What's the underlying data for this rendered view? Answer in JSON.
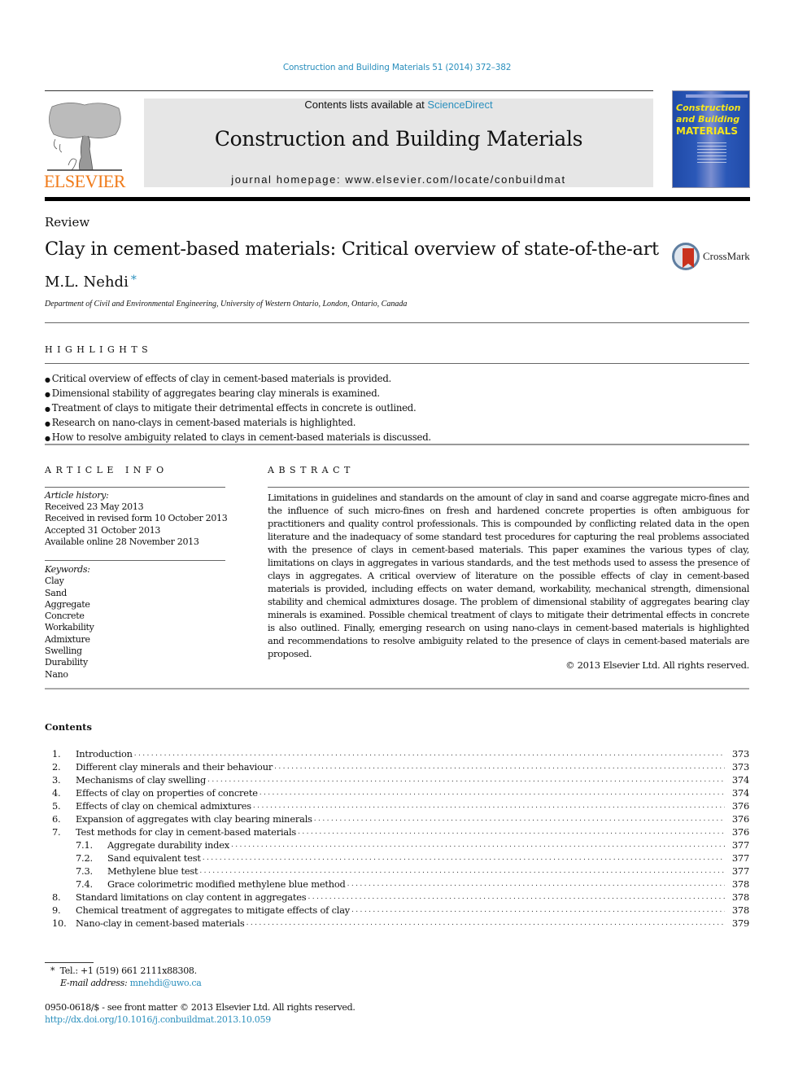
{
  "citation": "Construction and Building Materials 51 (2014) 372–382",
  "header": {
    "publisher_logo_text": "ELSEVIER",
    "contents_prefix": "Contents lists available at ",
    "contents_link": "ScienceDirect",
    "journal_title": "Construction and Building Materials",
    "homepage_prefix": "journal homepage: ",
    "homepage_url": "www.elsevier.com/locate/conbuildmat",
    "cover": {
      "line1": "Construction",
      "line2": "and Building",
      "line3": "MATERIALS"
    }
  },
  "article": {
    "type": "Review",
    "title": "Clay in cement-based materials: Critical overview of state-of-the-art",
    "author": "M.L. Nehdi",
    "author_mark": "*",
    "affiliation": "Department of Civil and Environmental Engineering, University of Western Ontario, London, Ontario, Canada",
    "crossmark_label": "CrossMark"
  },
  "highlights": {
    "heading": "HIGHLIGHTS",
    "items": [
      "Critical overview of effects of clay in cement-based materials is provided.",
      "Dimensional stability of aggregates bearing clay minerals is examined.",
      "Treatment of clays to mitigate their detrimental effects in concrete is outlined.",
      "Research on nano-clays in cement-based materials is highlighted.",
      "How to resolve ambiguity related to clays in cement-based materials is discussed."
    ]
  },
  "article_info": {
    "heading": "ARTICLE INFO",
    "history_label": "Article history:",
    "history": [
      "Received 23 May 2013",
      "Received in revised form 10 October 2013",
      "Accepted 31 October 2013",
      "Available online 28 November 2013"
    ],
    "keywords_label": "Keywords:",
    "keywords": [
      "Clay",
      "Sand",
      "Aggregate",
      "Concrete",
      "Workability",
      "Admixture",
      "Swelling",
      "Durability",
      "Nano"
    ]
  },
  "abstract": {
    "heading": "ABSTRACT",
    "text": "Limitations in guidelines and standards on the amount of clay in sand and coarse aggregate micro-fines and the influence of such micro-fines on fresh and hardened concrete properties is often ambiguous for practitioners and quality control professionals. This is compounded by conflicting related data in the open literature and the inadequacy of some standard test procedures for capturing the real problems associated with the presence of clays in cement-based materials. This paper examines the various types of clay, limitations on clays in aggregates in various standards, and the test methods used to assess the presence of clays in aggregates. A critical overview of literature on the possible effects of clay in cement-based materials is provided, including effects on water demand, workability, mechanical strength, dimensional stability and chemical admixtures dosage. The problem of dimensional stability of aggre­gates bearing clay minerals is examined. Possible chemical treatment of clays to mitigate their detrimen­tal effects in concrete is also outlined. Finally, emerging research on using nano-clays in cement-based materials is highlighted and recommendations to resolve ambiguity related to the presence of clays in cement-based materials are proposed.",
    "copyright": "© 2013 Elsevier Ltd. All rights reserved."
  },
  "contents": {
    "heading": "Contents",
    "items": [
      {
        "num": "1.",
        "label": "Introduction",
        "page": "373",
        "level": 1
      },
      {
        "num": "2.",
        "label": "Different clay minerals and their behaviour",
        "page": "373",
        "level": 1
      },
      {
        "num": "3.",
        "label": "Mechanisms of clay swelling",
        "page": "374",
        "level": 1
      },
      {
        "num": "4.",
        "label": "Effects of clay on properties of concrete",
        "page": "374",
        "level": 1
      },
      {
        "num": "5.",
        "label": "Effects of clay on chemical admixtures",
        "page": "376",
        "level": 1
      },
      {
        "num": "6.",
        "label": "Expansion of aggregates with clay bearing minerals",
        "page": "376",
        "level": 1
      },
      {
        "num": "7.",
        "label": "Test methods for clay in cement-based materials",
        "page": "376",
        "level": 1
      },
      {
        "num": "7.1.",
        "label": "Aggregate durability index",
        "page": "377",
        "level": 2
      },
      {
        "num": "7.2.",
        "label": "Sand equivalent test",
        "page": "377",
        "level": 2
      },
      {
        "num": "7.3.",
        "label": "Methylene blue test",
        "page": "377",
        "level": 2
      },
      {
        "num": "7.4.",
        "label": "Grace colorimetric modified methylene blue method",
        "page": "378",
        "level": 2
      },
      {
        "num": "8.",
        "label": "Standard limitations on clay content in aggregates",
        "page": "378",
        "level": 1
      },
      {
        "num": "9.",
        "label": "Chemical treatment of aggregates to mitigate effects of clay",
        "page": "378",
        "level": 1
      },
      {
        "num": "10.",
        "label": "Nano-clay in cement-based materials",
        "page": "379",
        "level": 1
      }
    ]
  },
  "footnote": {
    "mark": "*",
    "tel": "Tel.: +1 (519) 661 2111x88308.",
    "email_label": "E-mail address: ",
    "email": "mnehdi@uwo.ca"
  },
  "front_matter": {
    "issn_line": "0950-0618/$ - see front matter © 2013 Elsevier Ltd. All rights reserved.",
    "doi": "http://dx.doi.org/10.1016/j.conbuildmat.2013.10.059"
  },
  "colors": {
    "link": "#2a8fbd",
    "elsevier_orange": "#f07b1a",
    "cover_blue": "#1f4aa8",
    "cover_yellow": "#f5e51c",
    "banner_gray": "#e6e6e6"
  }
}
